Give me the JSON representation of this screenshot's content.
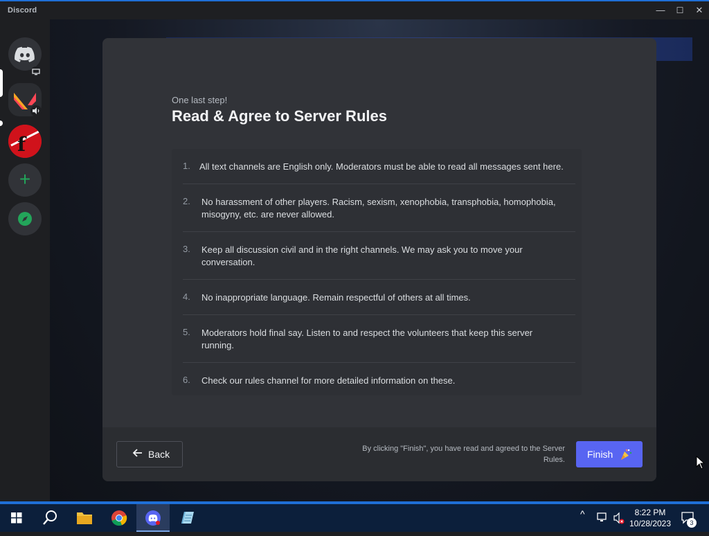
{
  "window": {
    "app_title": "Discord",
    "controls": {
      "minimize": "—",
      "maximize": "☐",
      "close": "✕"
    }
  },
  "sidebar": {
    "servers": [
      {
        "name": "home",
        "icon": "discord-logo-icon"
      },
      {
        "name": "valorant-server",
        "icon": "valorant-logo-icon",
        "badge_icon": "monitor-icon",
        "selected": true
      },
      {
        "name": "f-server",
        "icon": "f-logo-icon",
        "badge_icon": "speaker-icon",
        "unread": true
      },
      {
        "name": "add-server",
        "icon": "plus-icon",
        "glyph": "+"
      },
      {
        "name": "explore",
        "icon": "compass-icon"
      }
    ]
  },
  "modal": {
    "subtitle": "One last step!",
    "title": "Read & Agree to Server Rules",
    "rules": [
      {
        "num": "1.",
        "text": "All text channels are English only. Moderators must be able to read all messages sent here."
      },
      {
        "num": "2.",
        "text": "No harassment of other players. Racism, sexism, xenophobia, transphobia, homophobia, misogyny, etc. are never allowed."
      },
      {
        "num": "3.",
        "text": "Keep all discussion civil and in the right channels. We may ask you to move your conversation."
      },
      {
        "num": "4.",
        "text": "No inappropriate language. Remain respectful of others at all times."
      },
      {
        "num": "5.",
        "text": "Moderators hold final say. Listen to and respect the volunteers that keep this server running."
      },
      {
        "num": "6.",
        "text": "Check our rules channel for more detailed information on these."
      }
    ],
    "back_label": "Back",
    "back_icon": "arrow-left-icon",
    "legal_text": "By clicking \"Finish\", you have read and agreed to the Server Rules.",
    "finish_label": "Finish",
    "finish_icon": "party-popper-icon"
  },
  "taskbar": {
    "apps": [
      "start",
      "search",
      "file-explorer",
      "chrome",
      "discord",
      "notepad"
    ],
    "active_app": "discord",
    "tray": {
      "chevron": "^"
    },
    "time": "8:22 PM",
    "date": "10/28/2023",
    "notifications": "3"
  },
  "colors": {
    "accent": "#5865f2",
    "modal_bg": "#313338",
    "taskbar_bg": "#0c1f3b"
  }
}
